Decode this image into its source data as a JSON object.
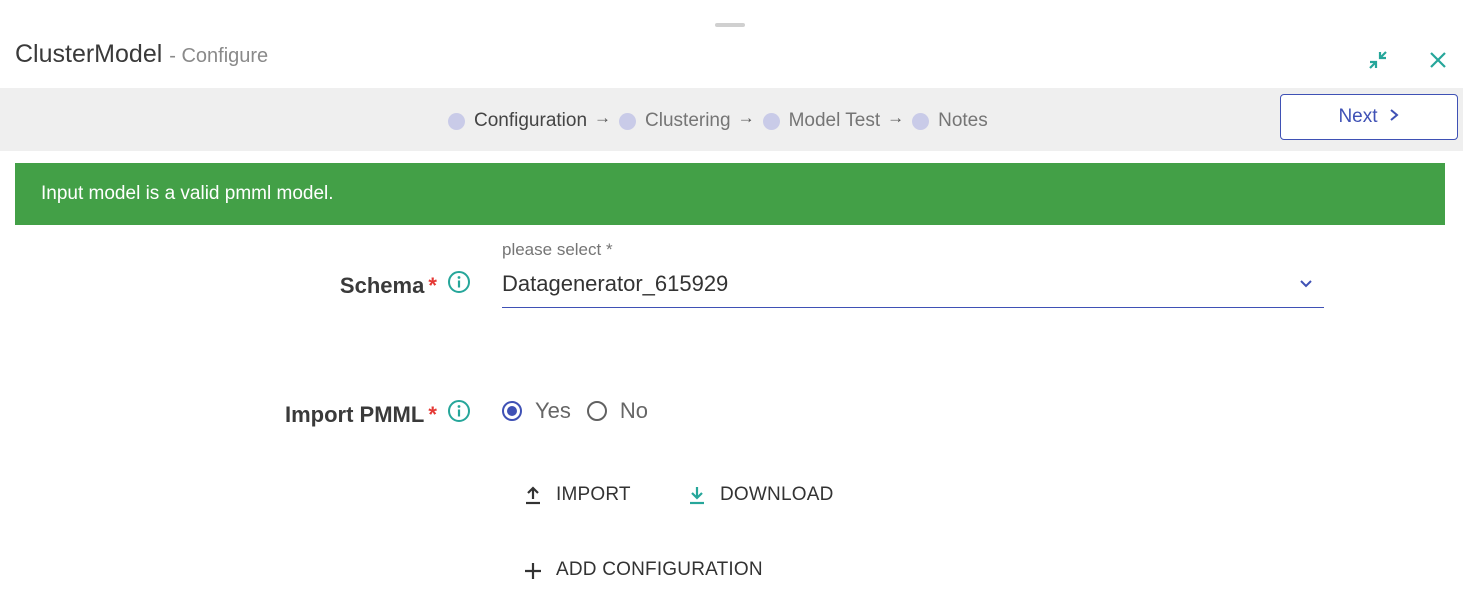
{
  "header": {
    "title": "ClusterModel",
    "subtitle": "- Configure"
  },
  "window_controls": {
    "minimize_icon": "collapse-arrows-icon",
    "close_icon": "close-icon",
    "accent_color": "#26a69a"
  },
  "stepper": {
    "steps": [
      {
        "label": "Configuration",
        "active": true
      },
      {
        "label": "Clustering",
        "active": false
      },
      {
        "label": "Model Test",
        "active": false
      },
      {
        "label": "Notes",
        "active": false
      }
    ],
    "separator": "→",
    "next_label": "Next"
  },
  "alert": {
    "message": "Input model is a valid pmml model.",
    "color": "#43a047"
  },
  "form": {
    "schema": {
      "label": "Schema",
      "required_mark": "*",
      "caption": "please select *",
      "value": "Datagenerator_615929"
    },
    "import_pmml": {
      "label": "Import PMML",
      "required_mark": "*",
      "options": [
        {
          "label": "Yes",
          "selected": true
        },
        {
          "label": "No",
          "selected": false
        }
      ]
    }
  },
  "actions": {
    "import_label": "IMPORT",
    "download_label": "DOWNLOAD",
    "add_configuration_label": "ADD CONFIGURATION"
  },
  "colors": {
    "primary": "#3f51b5",
    "teal": "#26a69a",
    "required": "#e53935"
  }
}
